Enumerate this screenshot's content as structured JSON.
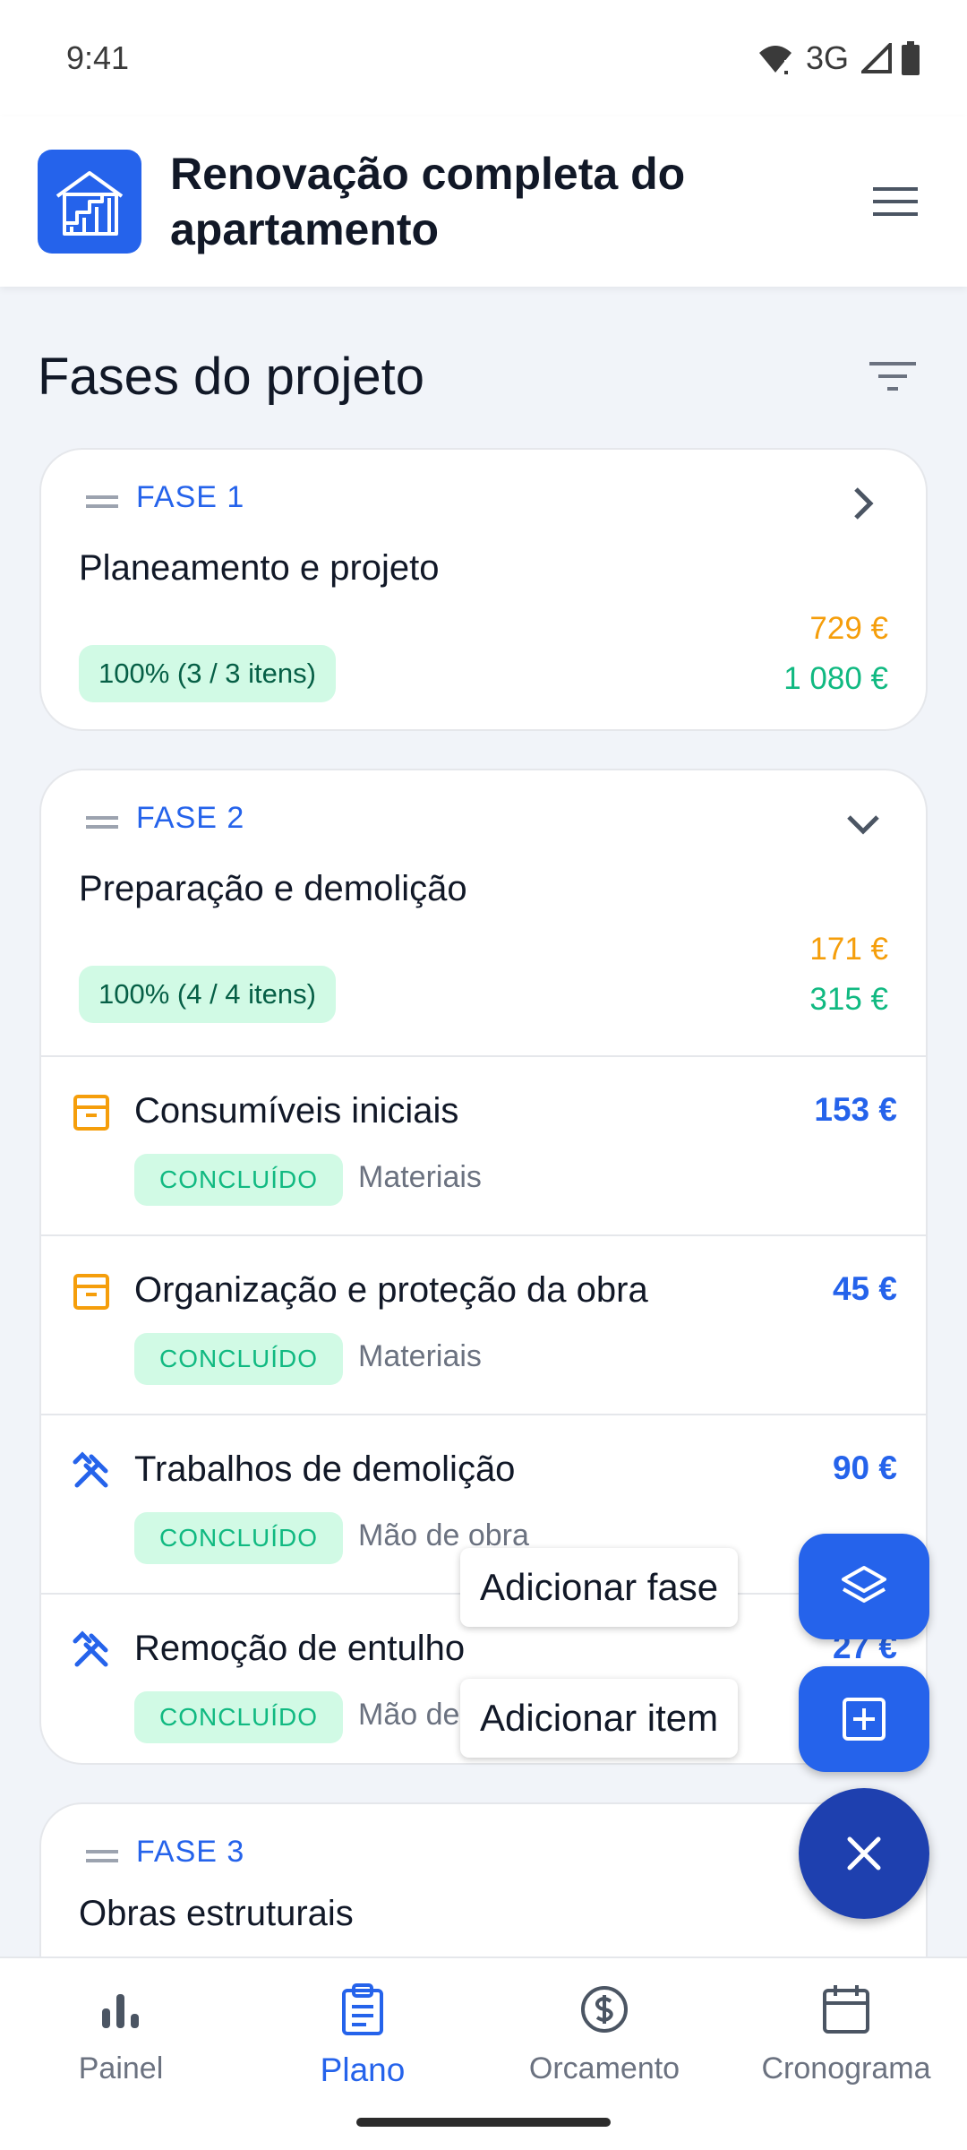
{
  "status_bar": {
    "time": "9:41",
    "network": "3G"
  },
  "header": {
    "title": "Renovação completa do apartamento"
  },
  "section": {
    "title": "Fases do projeto"
  },
  "phases": [
    {
      "label": "FASE 1",
      "name": "Planeamento e projeto",
      "progress": "100% (3 / 3 itens)",
      "planned": "729 €",
      "actual": "1 080 €",
      "expanded": false
    },
    {
      "label": "FASE 2",
      "name": "Preparação e demolição",
      "progress": "100% (4 / 4 itens)",
      "planned": "171 €",
      "actual": "315 €",
      "expanded": true,
      "items": [
        {
          "name": "Consumíveis iniciais",
          "amount": "153 €",
          "status": "CONCLUÍDO",
          "category": "Materiais",
          "icon": "box-icon"
        },
        {
          "name": "Organização e proteção da obra",
          "amount": "45 €",
          "status": "CONCLUÍDO",
          "category": "Materiais",
          "icon": "box-icon"
        },
        {
          "name": "Trabalhos de demolição",
          "amount": "90 €",
          "status": "CONCLUÍDO",
          "category": "Mão de obra",
          "icon": "tools-icon"
        },
        {
          "name": "Remoção de entulho",
          "amount": "27 €",
          "status": "CONCLUÍDO",
          "category": "Mão de obra",
          "icon": "tools-icon"
        }
      ]
    },
    {
      "label": "FASE 3",
      "name": "Obras estruturais"
    }
  ],
  "fab": {
    "add_phase_label": "Adicionar fase",
    "add_item_label": "Adicionar item"
  },
  "bottom_nav": [
    {
      "label": "Painel",
      "icon": "bar-chart-icon",
      "active": false
    },
    {
      "label": "Plano",
      "icon": "clipboard-icon",
      "active": true
    },
    {
      "label": "Orcamento",
      "icon": "dollar-icon",
      "active": false
    },
    {
      "label": "Cronograma",
      "icon": "calendar-icon",
      "active": false
    }
  ],
  "colors": {
    "primary": "#2563eb",
    "fab_main": "#1e40af",
    "planned": "#f59e0b",
    "actual": "#10b981",
    "badge_bg": "#d1fae5"
  }
}
